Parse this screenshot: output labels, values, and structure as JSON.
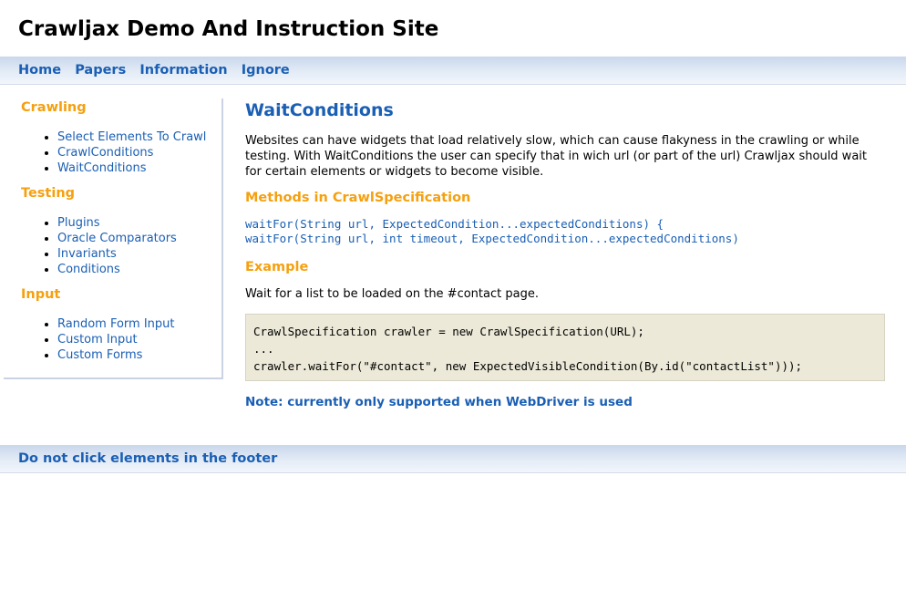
{
  "header": {
    "title": "Crawljax Demo And Instruction Site"
  },
  "nav": {
    "items": [
      "Home",
      "Papers",
      "Information",
      "Ignore"
    ]
  },
  "sidebar": {
    "sections": [
      {
        "title": "Crawling",
        "links": [
          "Select Elements To Crawl",
          "CrawlConditions",
          "WaitConditions"
        ]
      },
      {
        "title": "Testing",
        "links": [
          "Plugins",
          "Oracle Comparators",
          "Invariants",
          "Conditions"
        ]
      },
      {
        "title": "Input",
        "links": [
          "Random Form Input",
          "Custom Input",
          "Custom Forms"
        ]
      }
    ]
  },
  "main": {
    "heading": "WaitConditions",
    "intro": "Websites can have widgets that load relatively slow, which can cause flakyness in the crawling or while testing. With WaitConditions the user can specify that in wich url (or part of the url) Crawljax should wait for certain elements or widgets to become visible.",
    "methods_heading": "Methods in CrawlSpecification",
    "methods": [
      "waitFor(String url, ExpectedCondition...expectedConditions) {",
      "waitFor(String url, int timeout, ExpectedCondition...expectedConditions)"
    ],
    "example_heading": "Example",
    "example_text": "Wait for a list to be loaded on the #contact page.",
    "code_lines": [
      "CrawlSpecification crawler = new CrawlSpecification(URL);",
      "...",
      "crawler.waitFor(\"#contact\", new ExpectedVisibleCondition(By.id(\"contactList\")));"
    ],
    "note": "Note: currently only supported when WebDriver is used"
  },
  "footer": {
    "link": "Do not click elements in the footer"
  },
  "colors": {
    "link_blue": "#1a5fb4",
    "heading_orange": "#f5a00f",
    "code_bg": "#ece9d8"
  }
}
